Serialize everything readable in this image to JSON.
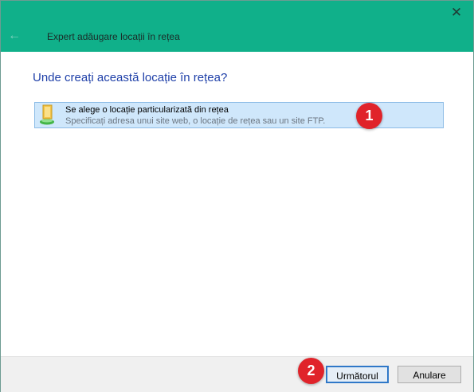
{
  "window": {
    "title": "Expert adăugare locații în rețea",
    "close_glyph": "✕",
    "back_glyph": "←",
    "title_bar_color": "#10b08a"
  },
  "main": {
    "heading": "Unde creați această locație în rețea?",
    "option": {
      "title": "Se alege o locație particularizată din rețea",
      "description": "Specificați adresa unui site web, o locație de rețea sau un site FTP.",
      "icon": "network-folder-icon"
    }
  },
  "annotations": [
    {
      "label": "1"
    },
    {
      "label": "2"
    }
  ],
  "footer": {
    "next_label": "Următorul",
    "cancel_label": "Anulare"
  }
}
